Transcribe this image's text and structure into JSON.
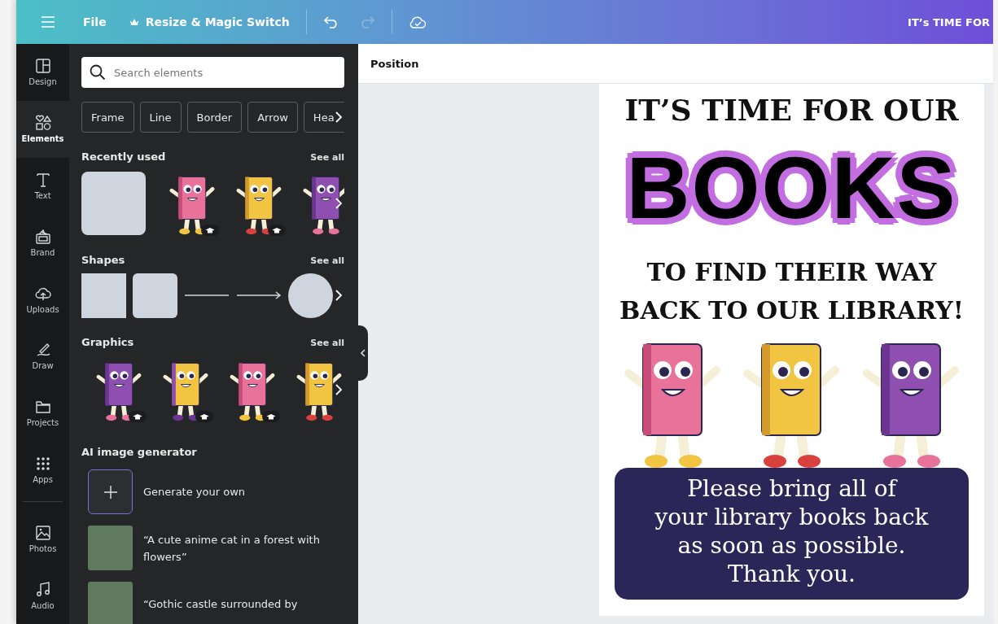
{
  "top_bar": {
    "file_label": "File",
    "resize_label": "Resize & Magic Switch",
    "undo_disabled": false,
    "redo_disabled": true,
    "document_title": "IT’s TIME FOR"
  },
  "sidebar": {
    "items": [
      {
        "label": "Design",
        "selected": false
      },
      {
        "label": "Elements",
        "selected": true
      },
      {
        "label": "Text",
        "selected": false
      },
      {
        "label": "Brand",
        "selected": false
      },
      {
        "label": "Uploads",
        "selected": false
      },
      {
        "label": "Draw",
        "selected": false
      },
      {
        "label": "Projects",
        "selected": false
      },
      {
        "label": "Apps",
        "selected": false
      },
      {
        "label": "Photos",
        "selected": false
      },
      {
        "label": "Audio",
        "selected": false
      }
    ]
  },
  "panel": {
    "search": {
      "placeholder": "Search elements"
    },
    "chips": [
      "Frame",
      "Line",
      "Border",
      "Arrow",
      "Hea"
    ],
    "sections": [
      {
        "kind": "recent",
        "title": "Recently used",
        "link": "See all"
      },
      {
        "kind": "shapes",
        "title": "Shapes",
        "link": "See all"
      },
      {
        "kind": "graphics",
        "title": "Graphics",
        "link": "See all"
      },
      {
        "kind": "generator",
        "title": "AI image generator",
        "items": [
          {
            "kind": "generate",
            "label": "Generate your own"
          },
          {
            "kind": "prompt",
            "label": "“A cute anime cat in a forest with flowers”"
          },
          {
            "kind": "prompt",
            "label": "“Gothic castle surrounded by"
          }
        ]
      }
    ]
  },
  "canvas": {
    "toolbar_label": "Position",
    "poster": {
      "heading": "IT’S TIME FOR OUR",
      "title": "BOOKS",
      "subheading_lines": [
        "TO FIND THEIR WAY",
        "BACK TO OUR LIBRARY!"
      ],
      "message_lines": [
        "Please bring all of",
        "your library books back",
        "as soon as possible.",
        "Thank you."
      ]
    }
  }
}
